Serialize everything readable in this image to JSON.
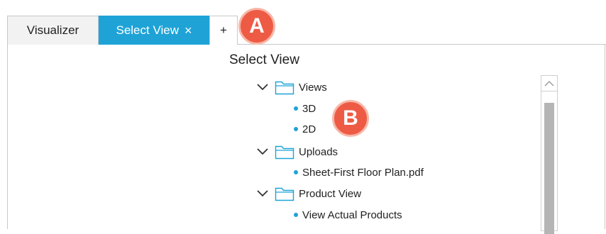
{
  "tabs": {
    "visualizer": "Visualizer",
    "active": "Select View",
    "close_glyph": "×",
    "add": "+"
  },
  "panel": {
    "title": "Select View"
  },
  "tree": {
    "folders": [
      {
        "label": "Views",
        "items": [
          "3D",
          "2D"
        ]
      },
      {
        "label": "Uploads",
        "items": [
          "Sheet-First Floor Plan.pdf"
        ]
      },
      {
        "label": "Product View",
        "items": [
          "View Actual Products"
        ]
      }
    ]
  },
  "callouts": {
    "a": "A",
    "b": "B"
  },
  "colors": {
    "accent": "#1fa3d7",
    "callout": "#ee5b45",
    "callout_ring": "#f8b7a8",
    "scroll_thumb": "#b5b5b5"
  }
}
